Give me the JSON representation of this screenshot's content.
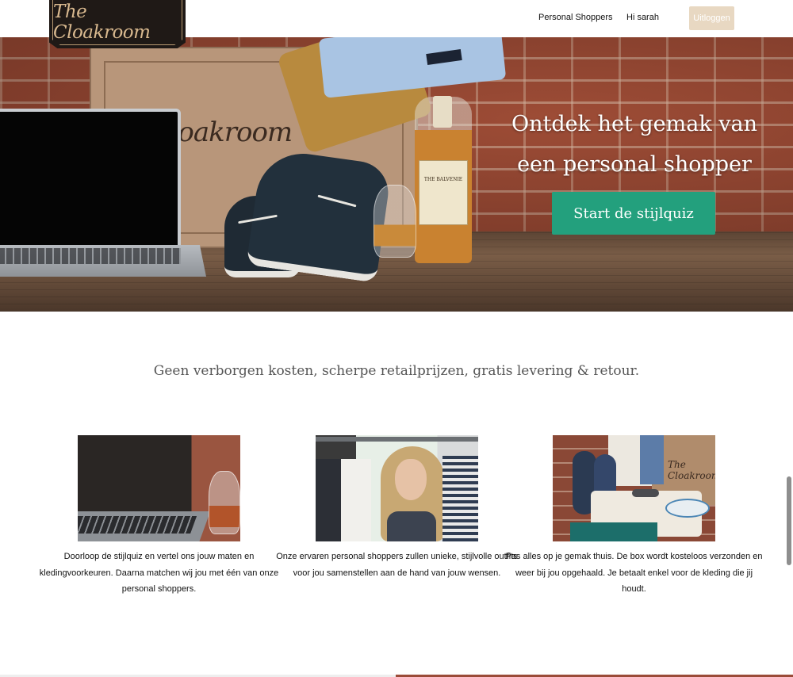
{
  "brand": {
    "logo_text": "The Cloakroom"
  },
  "nav": {
    "personal_shoppers": "Personal Shoppers",
    "greeting": "Hi sarah",
    "logout": "Uitloggen"
  },
  "hero": {
    "heading_line1": "Ontdek het gemak van",
    "heading_line2": "een personal shopper",
    "cta": "Start de stijlquiz",
    "box_logo": "The Cloakroom",
    "bottle_label": "THE BALVENIE"
  },
  "tagline": "Geen verborgen kosten, scherpe retailprijzen, gratis levering & retour.",
  "features": [
    {
      "text": "Doorloop de stijlquiz en vertel ons jouw maten en kledingvoorkeuren. Daarna matchen wij jou met één van onze personal shoppers."
    },
    {
      "text": "Onze ervaren personal shoppers zullen unieke, stijlvolle outfits voor jou samenstellen aan de hand van jouw wensen."
    },
    {
      "text": "Pas alles op je gemak thuis. De box wordt kosteloos verzonden en weer bij jou opgehaald. Je betaalt enkel voor de kleding die jij houdt."
    }
  ],
  "colors": {
    "accent_green": "#23a07d",
    "logout_bg": "#e8d8c2",
    "logo_bg": "#1f1916",
    "logo_gold": "#d9b98f"
  }
}
